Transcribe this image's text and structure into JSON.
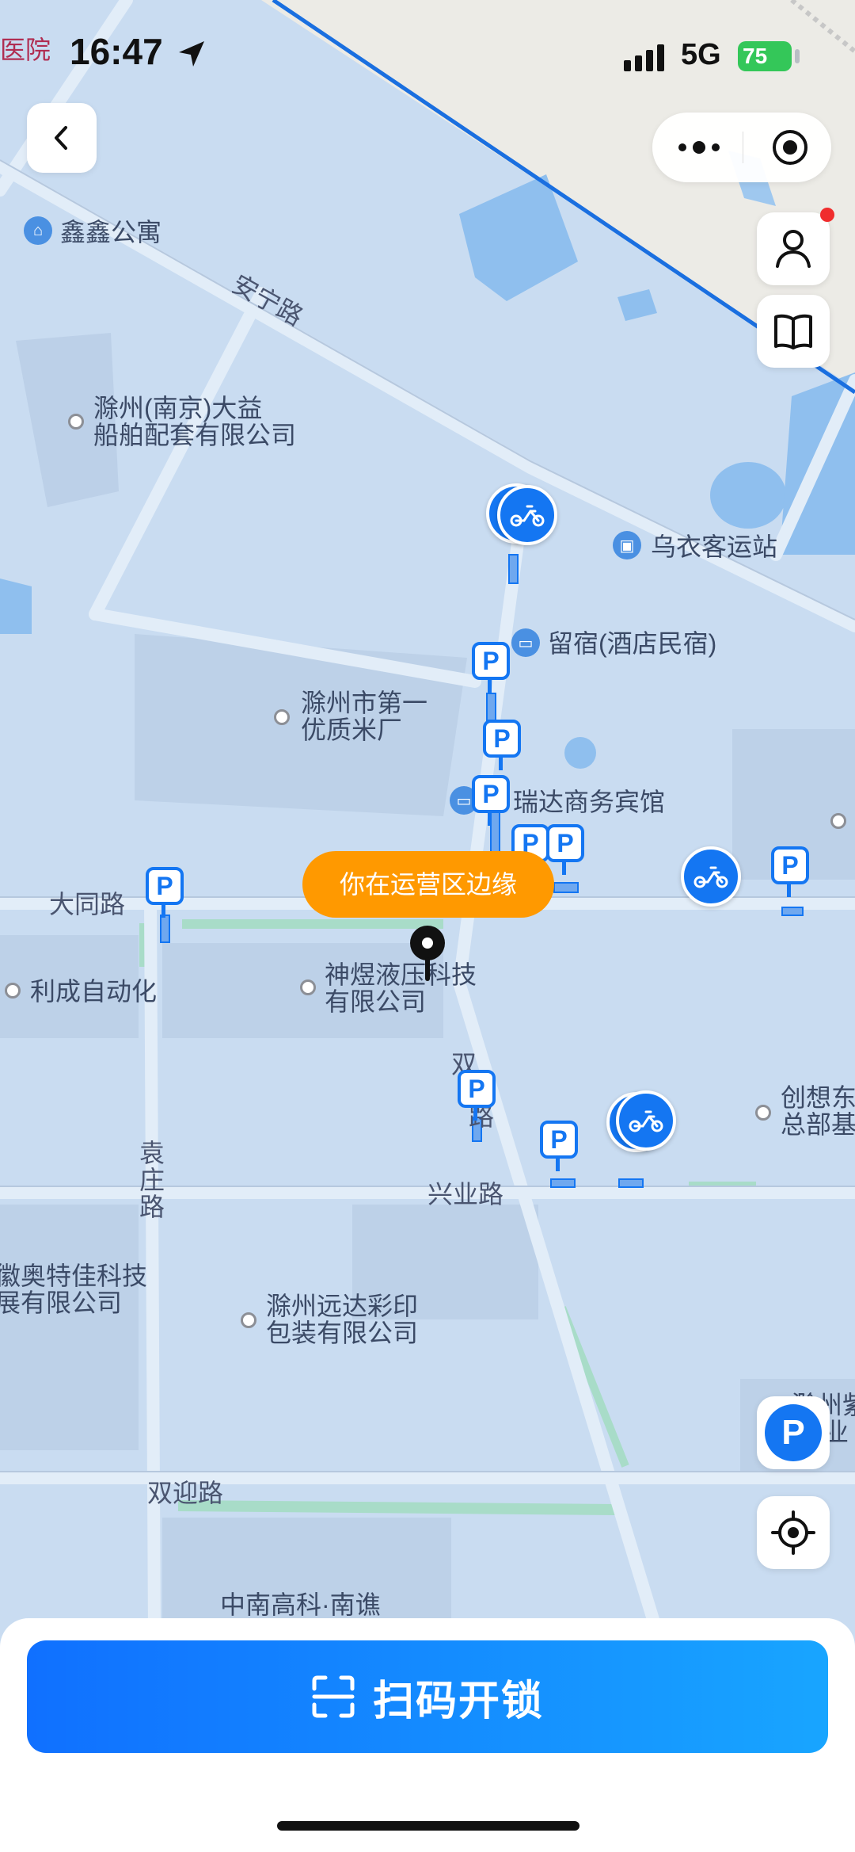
{
  "status_bar": {
    "time": "16:47",
    "network": "5G",
    "battery": "75",
    "corner_label": "医院"
  },
  "header": {
    "back_icon": "chevron-left-icon",
    "more_icon": "more-dots-icon",
    "close_icon": "target-circle-icon"
  },
  "side_buttons": {
    "profile_icon": "person-icon",
    "guide_icon": "book-icon"
  },
  "map": {
    "labels": {
      "xinxin": "鑫鑫公寓",
      "anning_road": "安宁路",
      "chuzhou_nanjing_1": "滁州(南京)大益",
      "chuzhou_nanjing_2": "船舶配套有限公司",
      "wuyi_station": "乌衣客运站",
      "liusu": "留宿(酒店民宿)",
      "rice_factory_1": "滁州市第一",
      "rice_factory_2": "优质米厂",
      "ruida_hotel": "瑞达商务宾馆",
      "datong_road": "大同路",
      "licheng": "利成自动化",
      "shenyu_1": "神煜液压科技",
      "shenyu_2": "有限公司",
      "shuang_road_1": "双",
      "shuang_road_2": "路",
      "chuangxiang_1": "创想东",
      "chuangxiang_2": "总部基",
      "yuanzhuang_1": "袁",
      "yuanzhuang_2": "庄",
      "yuanzhuang_3": "路",
      "xingye_road": "兴业路",
      "aote_1": "徽奥特佳科技",
      "aote_2": "展有限公司",
      "yuanda_1": "滁州远达彩印",
      "yuanda_2": "包装有限公司",
      "shuangying_road": "双迎路",
      "zhongnan": "中南高科·南谯",
      "zi_1": "滁州紫",
      "zi_2": "业"
    },
    "parking_letter": "P",
    "tooltip": "你在运营区边缘"
  },
  "bottom": {
    "scan_label": "扫码开锁",
    "scan_icon": "scan-frame-icon"
  },
  "colors": {
    "accent": "#1476f2",
    "tooltip": "#ff9900",
    "boundary": "#1a6fe0"
  }
}
